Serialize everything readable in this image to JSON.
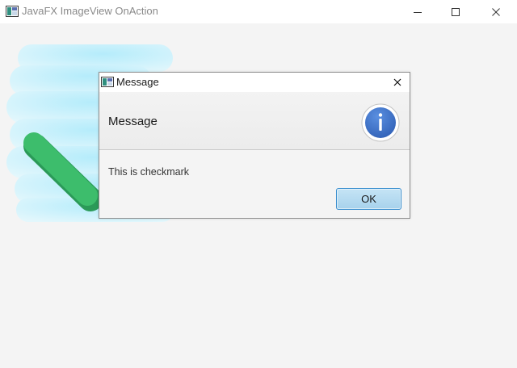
{
  "window": {
    "title": "JavaFX ImageView OnAction",
    "icon": "java-window-icon",
    "controls": [
      "minimize-icon",
      "maximize-icon",
      "close-icon"
    ]
  },
  "image_view": {
    "icon": "checkmark-icon",
    "check_color": "#3dbd6c",
    "glow_color": "#c9f1fb"
  },
  "dialog": {
    "title": "Message",
    "header_text": "Message",
    "content_text": "This is checkmark",
    "ok_label": "OK",
    "info_icon": "information-icon",
    "info_color": "#3c6fc7"
  }
}
